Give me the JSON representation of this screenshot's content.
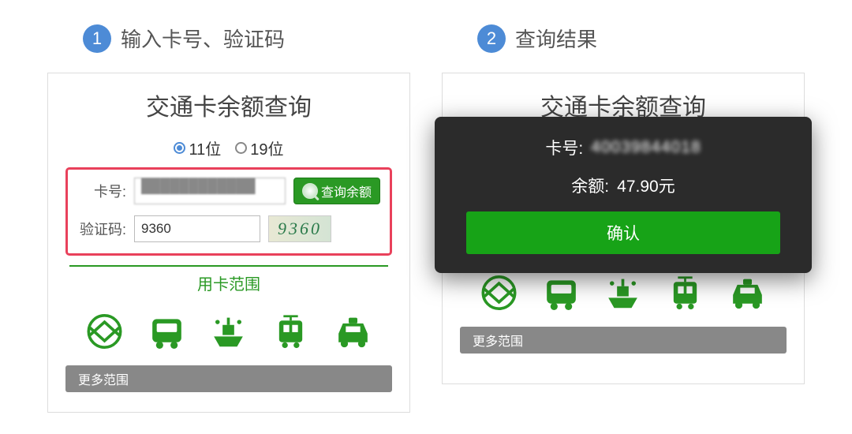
{
  "step1": {
    "number": "1",
    "title": "输入卡号、验证码"
  },
  "step2": {
    "number": "2",
    "title": "查询结果"
  },
  "panel": {
    "title": "交通卡余额查询",
    "radio11": "11位",
    "radio19": "19位",
    "card_label": "卡号:",
    "card_value": "████████████",
    "captcha_label": "验证码:",
    "captcha_value": "9360",
    "captcha_img_text": "9360",
    "query_btn": "查询余额",
    "scope_label": "用卡范围",
    "more_btn": "更多范围"
  },
  "modal": {
    "card_label": "卡号:",
    "card_value": "40039844018",
    "balance_label": "余额:",
    "balance_value": "47.90元",
    "confirm": "确认"
  },
  "icons": {
    "metro": "metro-icon",
    "bus": "bus-icon",
    "ferry": "ferry-icon",
    "tram": "tram-icon",
    "taxi": "taxi-icon"
  }
}
